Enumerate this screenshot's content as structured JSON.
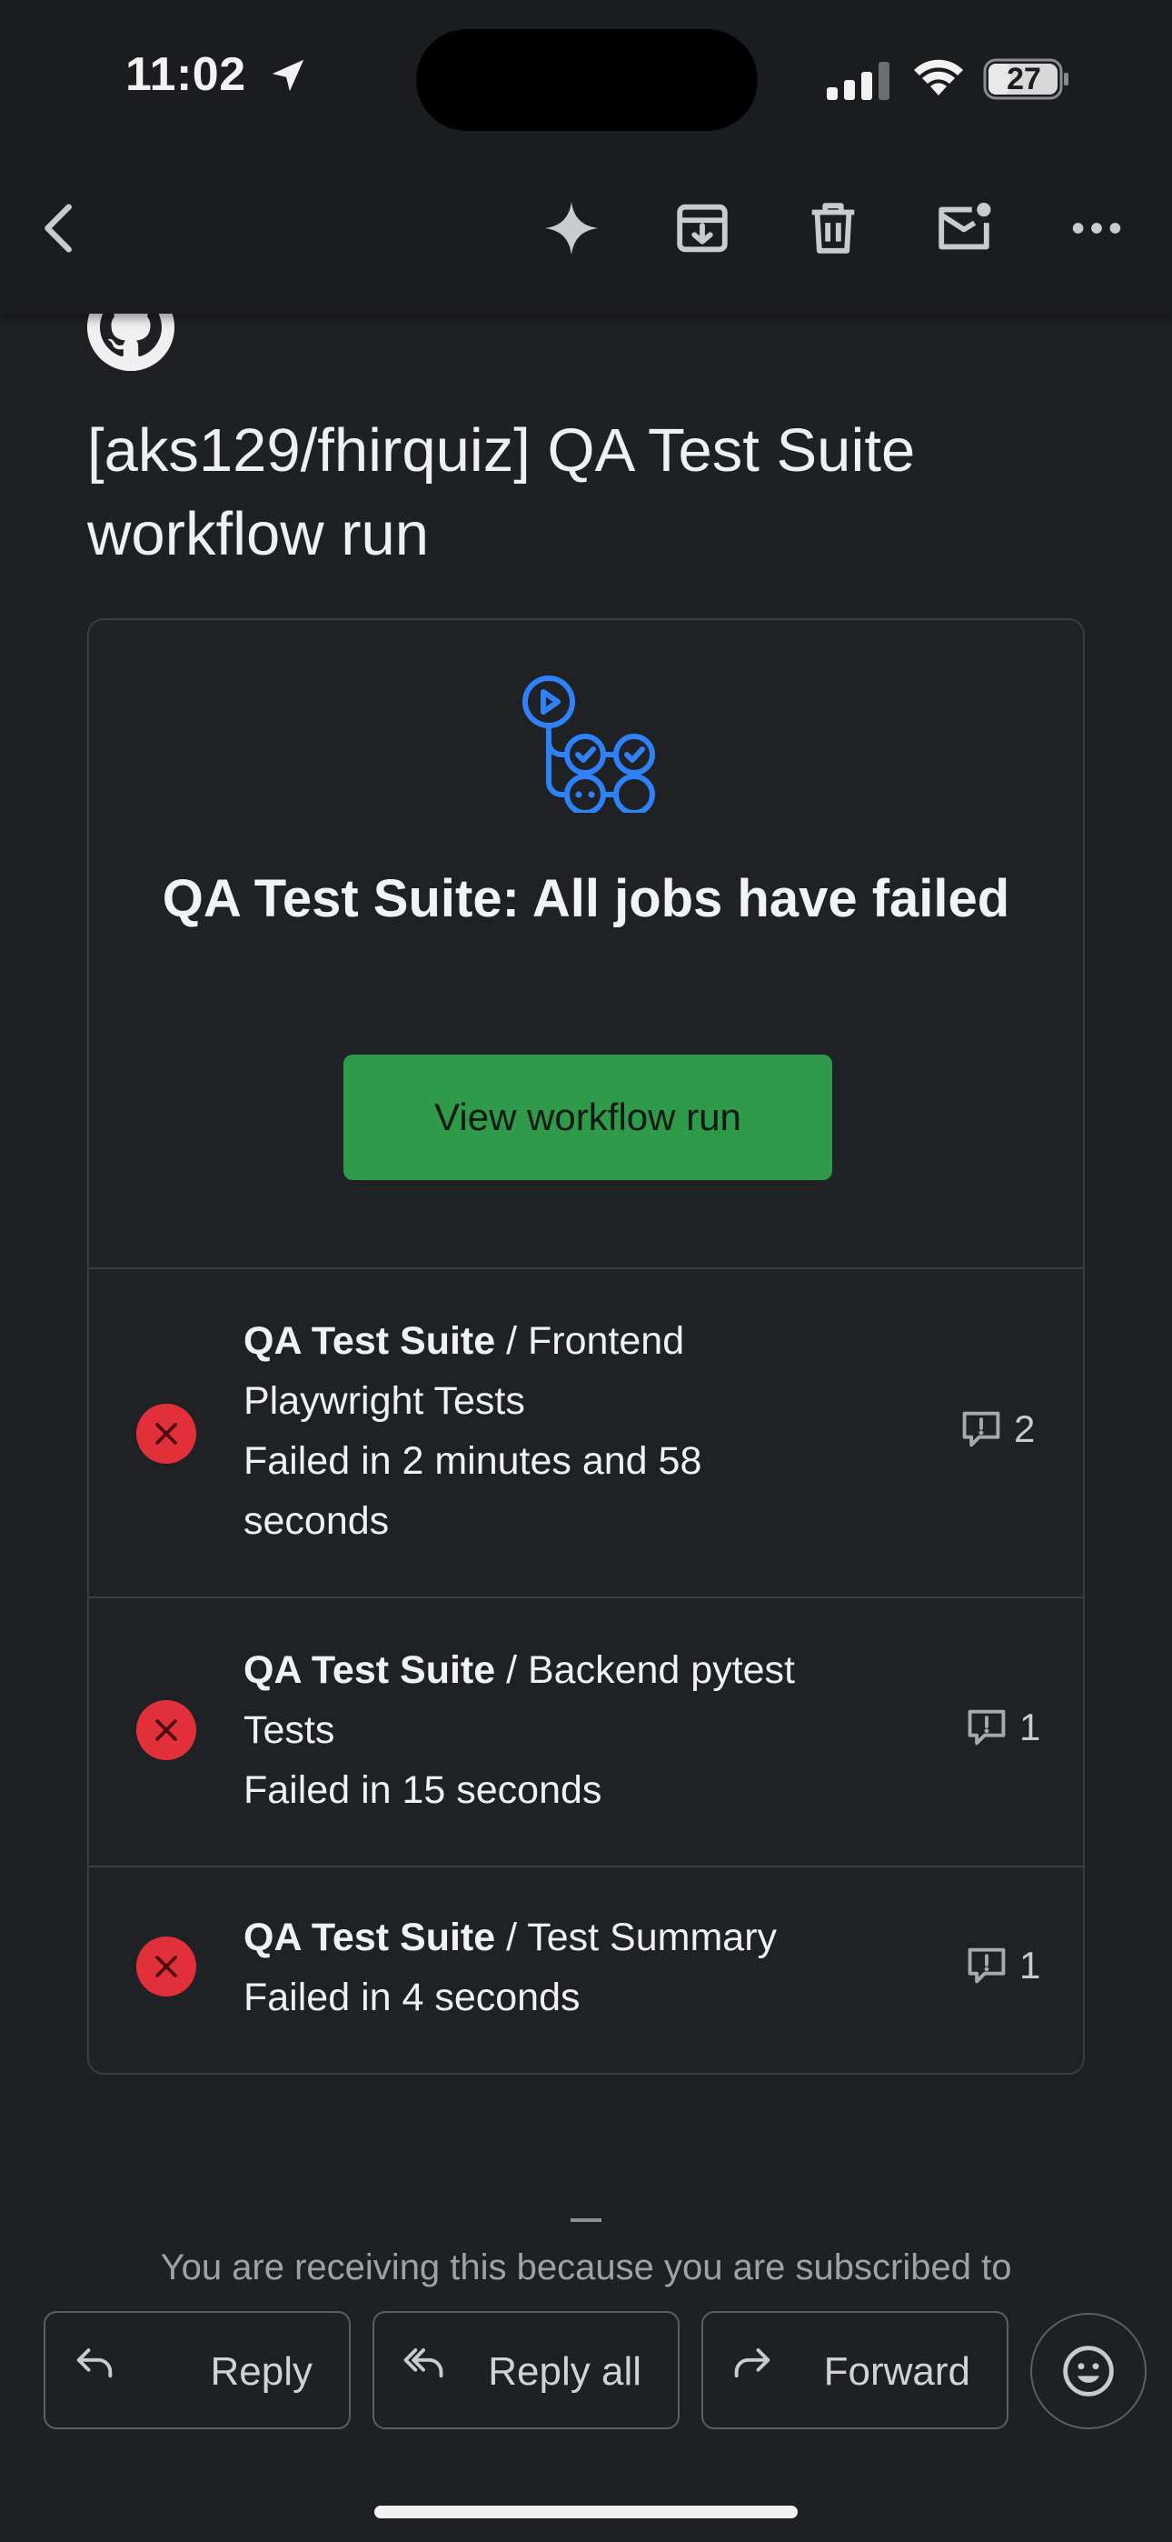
{
  "status_bar": {
    "time": "11:02",
    "battery": "27"
  },
  "email": {
    "subject": "[aks129/fhirquiz] QA Test Suite workflow run",
    "card_title": "QA Test Suite: All jobs have failed",
    "view_button": "View workflow run",
    "jobs": [
      {
        "workflow": "QA Test Suite",
        "separator": " / ",
        "job_line1": "Frontend",
        "job_line2": "Playwright Tests",
        "status_line1": "Failed in 2 minutes and 58",
        "status_line2": "seconds",
        "comments": "2"
      },
      {
        "workflow": "QA Test Suite",
        "separator": " / ",
        "job_line1": "Backend pytest",
        "job_line2": "Tests",
        "status_line1": "Failed in 15 seconds",
        "comments": "1"
      },
      {
        "workflow": "QA Test Suite",
        "separator": " / ",
        "job_line1": "Test Summary",
        "status_line1": "Failed in 4 seconds",
        "comments": "1"
      }
    ],
    "footer_note": "You are receiving this because you are subscribed to"
  },
  "reply_bar": {
    "reply": "Reply",
    "reply_all": "Reply all",
    "forward": "Forward"
  },
  "icons": {
    "back": "chevron-left-icon",
    "gemini": "sparkle-icon",
    "archive": "archive-icon",
    "delete": "trash-icon",
    "mark_unread": "mail-unread-icon",
    "more": "more-horizontal-icon",
    "emoji": "emoji-smile-icon"
  },
  "colors": {
    "background": "#1f2024",
    "button_green": "#2f9a4a",
    "fail_red": "#e1303a",
    "actions_blue": "#2f81f7"
  }
}
